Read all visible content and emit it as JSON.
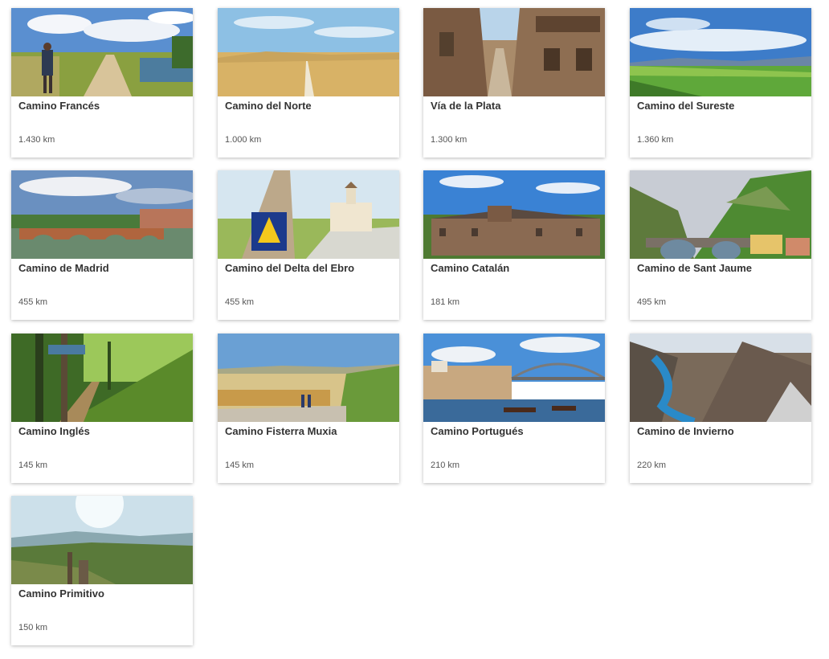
{
  "routes": [
    {
      "name": "Camino Francés",
      "distance": "1.430 km",
      "image": "pilgrim-path-photo"
    },
    {
      "name": "Camino del Norte",
      "distance": "1.000 km",
      "image": "wheat-field-photo"
    },
    {
      "name": "Vía de la Plata",
      "distance": "1.300 km",
      "image": "stone-village-street-photo"
    },
    {
      "name": "Camino del Sureste",
      "distance": "1.360 km",
      "image": "green-valley-photo"
    },
    {
      "name": "Camino de Madrid",
      "distance": "455 km",
      "image": "roman-bridge-photo"
    },
    {
      "name": "Camino del Delta del Ebro",
      "distance": "455 km",
      "image": "scallop-marker-lighthouse-photo"
    },
    {
      "name": "Camino Catalán",
      "distance": "181 km",
      "image": "monastery-photo"
    },
    {
      "name": "Camino de Sant Jaume",
      "distance": "495 km",
      "image": "mountain-bridge-photo"
    },
    {
      "name": "Camino Inglés",
      "distance": "145 km",
      "image": "forest-path-photo"
    },
    {
      "name": "Camino Fisterra Muxia",
      "distance": "145 km",
      "image": "walkers-fields-photo"
    },
    {
      "name": "Camino Portugués",
      "distance": "210 km",
      "image": "porto-bridge-photo"
    },
    {
      "name": "Camino de Invierno",
      "distance": "220 km",
      "image": "river-canyon-photo"
    },
    {
      "name": "Camino Primitivo",
      "distance": "150 km",
      "image": "misty-hills-photo"
    }
  ]
}
